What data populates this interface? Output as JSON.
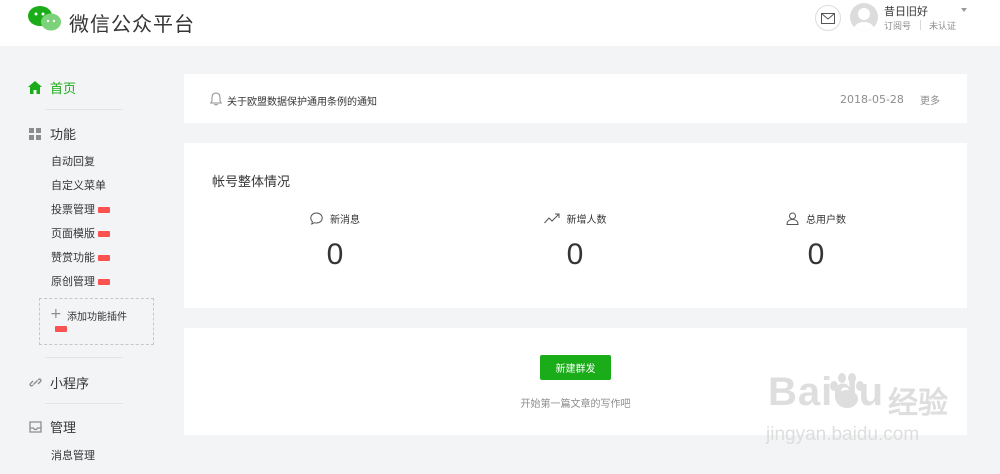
{
  "header": {
    "brand": "微信公众平台",
    "account": {
      "name": "昔日旧好",
      "type": "订阅号",
      "status": "未认证"
    }
  },
  "sidebar": {
    "home": {
      "label": "首页"
    },
    "features": {
      "label": "功能",
      "items": [
        {
          "label": "自动回复",
          "new": false
        },
        {
          "label": "自定义菜单",
          "new": false
        },
        {
          "label": "投票管理",
          "new": true
        },
        {
          "label": "页面模版",
          "new": true
        },
        {
          "label": "赞赏功能",
          "new": true
        },
        {
          "label": "原创管理",
          "new": true
        }
      ],
      "add_plugin": "添加功能插件"
    },
    "miniprogram": {
      "label": "小程序"
    },
    "manage": {
      "label": "管理",
      "items": [
        {
          "label": "消息管理"
        }
      ]
    }
  },
  "notice": {
    "text": "关于欧盟数据保护通用条例的通知",
    "date": "2018-05-28",
    "more": "更多"
  },
  "stats": {
    "title": "帐号整体情况",
    "items": [
      {
        "label": "新消息",
        "value": "0",
        "icon": "chat-bubble-icon"
      },
      {
        "label": "新增人数",
        "value": "0",
        "icon": "trend-up-icon"
      },
      {
        "label": "总用户数",
        "value": "0",
        "icon": "user-icon"
      }
    ]
  },
  "mass": {
    "button": "新建群发",
    "hint": "开始第一篇文章的写作吧"
  },
  "watermark": {
    "text": "Baidu",
    "cn": "经验",
    "url": "jingyan.baidu.com"
  },
  "colors": {
    "accent": "#1aad19",
    "badge": "#fa5151",
    "background": "#f3f4f6"
  }
}
